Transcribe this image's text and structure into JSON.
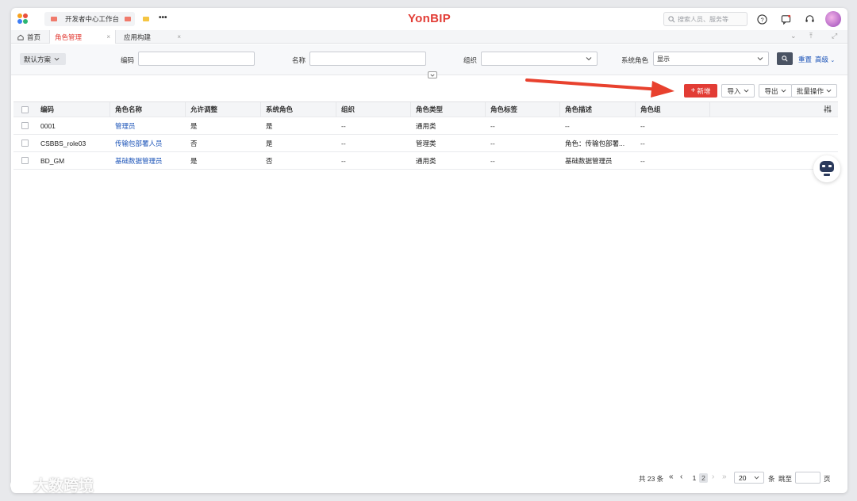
{
  "topbar": {
    "brand": "YonBIP",
    "open_apps": [
      {
        "label": "开发者中心工作台"
      }
    ],
    "more": "•••",
    "search_placeholder": "搜索人员、服务等"
  },
  "tabs": [
    {
      "label": "首页"
    },
    {
      "label": "角色管理",
      "close": "×"
    },
    {
      "label": "应用构建",
      "close": "×"
    }
  ],
  "filter": {
    "scheme_label": "默认方案",
    "fields": [
      {
        "label": "编码",
        "value": ""
      },
      {
        "label": "名称",
        "value": ""
      },
      {
        "label": "组织",
        "value": ""
      },
      {
        "label": "系统角色",
        "value": "显示"
      }
    ],
    "reset_label": "重置",
    "advanced_label": "高级"
  },
  "toolbar": {
    "add_label": "新增",
    "import_label": "导入",
    "export_label": "导出",
    "batch_label": "批量操作"
  },
  "table": {
    "columns": [
      "编码",
      "角色名称",
      "允许调整",
      "系统角色",
      "组织",
      "角色类型",
      "角色标签",
      "角色描述",
      "角色组"
    ],
    "rows": [
      {
        "code": "0001",
        "name": "管理员",
        "adjust": "是",
        "system": "是",
        "org": "--",
        "type": "通用类",
        "tag": "--",
        "desc": "--",
        "group": "--"
      },
      {
        "code": "CSBBS_role03",
        "name": "传输包部署人员",
        "adjust": "否",
        "system": "是",
        "org": "--",
        "type": "管理类",
        "tag": "--",
        "desc": "角色：传输包部署...",
        "group": "--"
      },
      {
        "code": "BD_GM",
        "name": "基础数据管理员",
        "adjust": "是",
        "system": "否",
        "org": "--",
        "type": "通用类",
        "tag": "--",
        "desc": "基础数据管理员",
        "group": "--"
      }
    ]
  },
  "pagination": {
    "total_text": "共 23 条",
    "page_prev_pages": "1",
    "current_page": "2",
    "page_size": "20",
    "per_page_unit": "条",
    "jump_label": "跳至",
    "page_unit": "页"
  },
  "watermark": "大数跨境",
  "colors": {
    "accent": "#e23c35",
    "link": "#1c54b8"
  }
}
